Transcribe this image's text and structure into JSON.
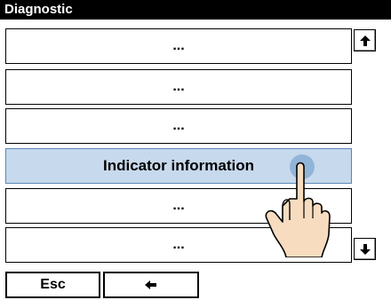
{
  "window": {
    "title": "Diagnostic"
  },
  "menu": {
    "items": [
      {
        "label": "..."
      },
      {
        "label": "..."
      },
      {
        "label": "..."
      },
      {
        "label": "Indicator information",
        "selected": true
      },
      {
        "label": "..."
      },
      {
        "label": "..."
      }
    ]
  },
  "scroll": {
    "up_icon": "arrow-up-icon",
    "down_icon": "arrow-down-icon"
  },
  "footer": {
    "esc_label": "Esc",
    "back_icon": "arrow-left-icon"
  },
  "colors": {
    "selected_bg": "#c7d9ec",
    "selected_border": "#5a86b8",
    "title_bg": "#000000",
    "touch_dot": "#7fa8d1"
  }
}
